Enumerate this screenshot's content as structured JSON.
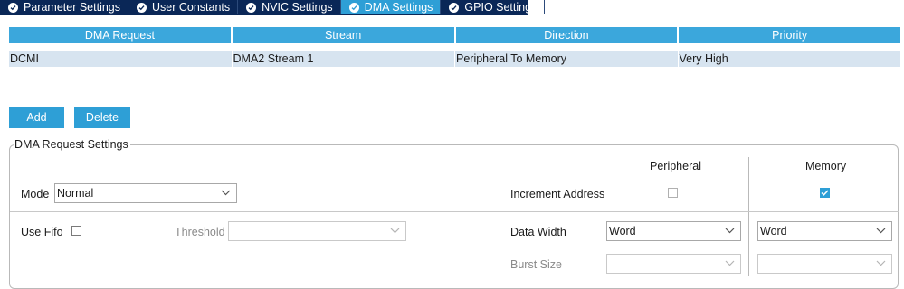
{
  "tabs": [
    {
      "label": "Parameter Settings",
      "active": false
    },
    {
      "label": "User Constants",
      "active": false
    },
    {
      "label": "NVIC Settings",
      "active": false
    },
    {
      "label": "DMA Settings",
      "active": true
    },
    {
      "label": "GPIO Settings",
      "active": false
    }
  ],
  "table": {
    "headers": [
      "DMA Request",
      "Stream",
      "Direction",
      "Priority"
    ],
    "rows": [
      [
        "DCMI",
        "DMA2 Stream 1",
        "Peripheral To Memory",
        "Very High"
      ]
    ]
  },
  "buttons": {
    "add": "Add",
    "delete": "Delete"
  },
  "settings": {
    "title": "DMA Request Settings",
    "peripheral_header": "Peripheral",
    "memory_header": "Memory",
    "mode_label": "Mode",
    "mode_value": "Normal",
    "increment_address_label": "Increment Address",
    "increment_peripheral": false,
    "increment_memory": true,
    "use_fifo_label": "Use Fifo",
    "use_fifo": false,
    "threshold_label": "Threshold",
    "threshold_value": "",
    "data_width_label": "Data Width",
    "data_width_peripheral": "Word",
    "data_width_memory": "Word",
    "burst_size_label": "Burst Size",
    "burst_size_peripheral": "",
    "burst_size_memory": ""
  },
  "colors": {
    "tab_bar": "#0a2757",
    "accent": "#2e9fd6",
    "row_selected": "#d7e4f0"
  }
}
